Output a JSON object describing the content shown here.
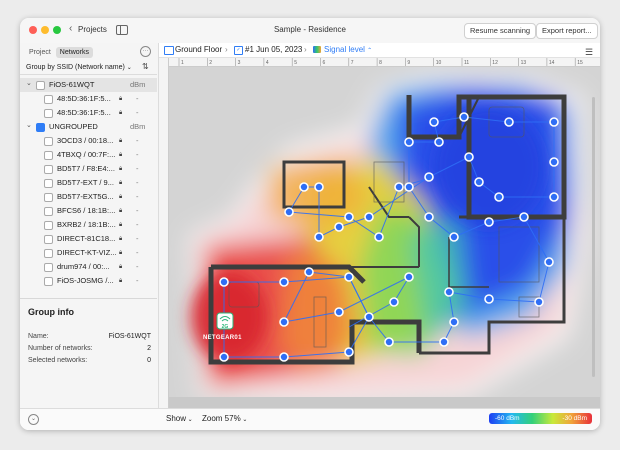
{
  "window": {
    "title": "Sample - Residence"
  },
  "titlebar": {
    "back_label": "Projects",
    "resume_label": "Resume scanning",
    "export_label": "Export report..."
  },
  "sidebar": {
    "segments": [
      "Project",
      "Networks"
    ],
    "group_by": "Group by SSID (Network name)",
    "rows": [
      {
        "type": "group",
        "label": "FiOS-61WQT",
        "value": "dBm",
        "expanded": true,
        "selected": true
      },
      {
        "type": "item",
        "label": "48:5D:36:1F:5...",
        "lock": true,
        "value": "-"
      },
      {
        "type": "item",
        "label": "48:5D:36:1F:5...",
        "lock": true,
        "value": "-"
      },
      {
        "type": "group",
        "label": "UNGROUPED",
        "value": "dBm",
        "expanded": true,
        "checked": true
      },
      {
        "type": "item",
        "label": "3OCD3 / 00:18...",
        "lock": true,
        "value": "-"
      },
      {
        "type": "item",
        "label": "4TBXQ / 00:7F:...",
        "lock": true,
        "value": "-"
      },
      {
        "type": "item",
        "label": "BD5T7 / F8:E4:...",
        "lock": true,
        "value": "-"
      },
      {
        "type": "item",
        "label": "BD5T7-EXT / 9...",
        "lock": true,
        "value": "-"
      },
      {
        "type": "item",
        "label": "BD5T7-EXT5G...",
        "lock": true,
        "value": "-"
      },
      {
        "type": "item",
        "label": "BFCS6 / 18:1B:...",
        "lock": true,
        "value": "-"
      },
      {
        "type": "item",
        "label": "BXRB2 / 18:1B:...",
        "lock": true,
        "value": "-"
      },
      {
        "type": "item",
        "label": "DIRECT-81C18...",
        "lock": true,
        "value": "-"
      },
      {
        "type": "item",
        "label": "DIRECT-KT-VIZ...",
        "lock": true,
        "value": "-"
      },
      {
        "type": "item",
        "label": "drum974 / 00:...",
        "lock": true,
        "value": "-"
      },
      {
        "type": "item",
        "label": "FiOS-JOSMG /...",
        "lock": true,
        "value": "-"
      }
    ],
    "group_info": {
      "title": "Group info",
      "rows": [
        {
          "key": "Name:",
          "value": "FiOS-61WQT"
        },
        {
          "key": "Number of networks:",
          "value": "2"
        },
        {
          "key": "Selected networks:",
          "value": "0"
        }
      ]
    }
  },
  "toolbar": {
    "floor": "Ground Floor",
    "survey": "#1 Jun 05, 2023",
    "visualization": "Signal level"
  },
  "ruler": {
    "ticks": [
      "1",
      "2",
      "3",
      "4",
      "5",
      "6",
      "7",
      "8",
      "9",
      "10",
      "11",
      "12",
      "13",
      "14",
      "15"
    ]
  },
  "map": {
    "ap_badge": "2G",
    "ap_label": "NETGEAR01"
  },
  "bottombar": {
    "show_label": "Show",
    "zoom_label": "Zoom 57%"
  },
  "legend": {
    "min_label": "-60 dBm",
    "max_label": "-30 dBm"
  },
  "colors": {
    "accent": "#2f7df6",
    "point": "#2f6ef5",
    "wall": "#3d3d3d"
  }
}
